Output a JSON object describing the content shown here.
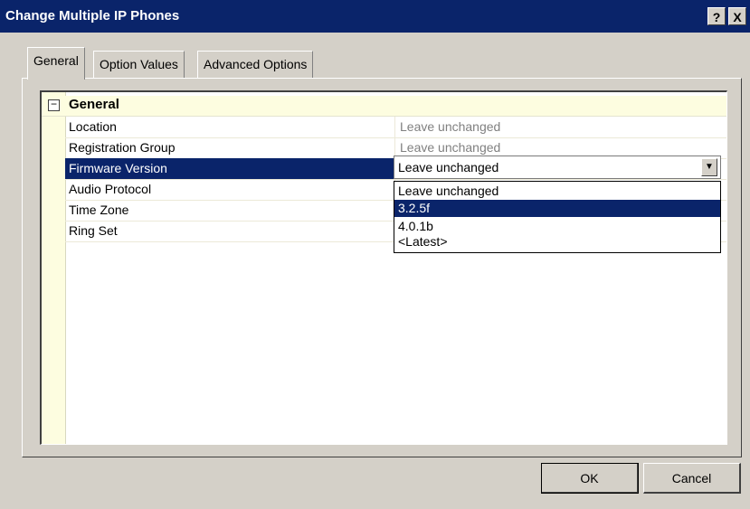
{
  "window": {
    "title": "Change Multiple IP Phones",
    "help_label": "?",
    "close_label": "X"
  },
  "tabs": [
    {
      "label": "General",
      "active": true
    },
    {
      "label": "Option Values",
      "active": false
    },
    {
      "label": "Advanced Options",
      "active": false
    }
  ],
  "grid": {
    "category": {
      "label": "General",
      "expander": "−"
    },
    "rows": [
      {
        "name": "Location",
        "value": "Leave unchanged"
      },
      {
        "name": "Registration Group",
        "value": "Leave unchanged"
      },
      {
        "name": "Firmware Version",
        "value": "Leave unchanged",
        "selected": true
      },
      {
        "name": "Audio Protocol",
        "value": ""
      },
      {
        "name": "Time Zone",
        "value": ""
      },
      {
        "name": "Ring Set",
        "value": ""
      }
    ]
  },
  "combo": {
    "value": "Leave unchanged",
    "arrow": "▼",
    "options": [
      "Leave unchanged",
      "3.2.5f",
      "4.0.1b",
      "<Latest>"
    ],
    "highlighted": "3.2.5f"
  },
  "buttons": {
    "ok": "OK",
    "cancel": "Cancel"
  },
  "colors": {
    "titlebar": "#0a246a",
    "selection": "#0a246a",
    "dialog": "#d4d0c8"
  }
}
